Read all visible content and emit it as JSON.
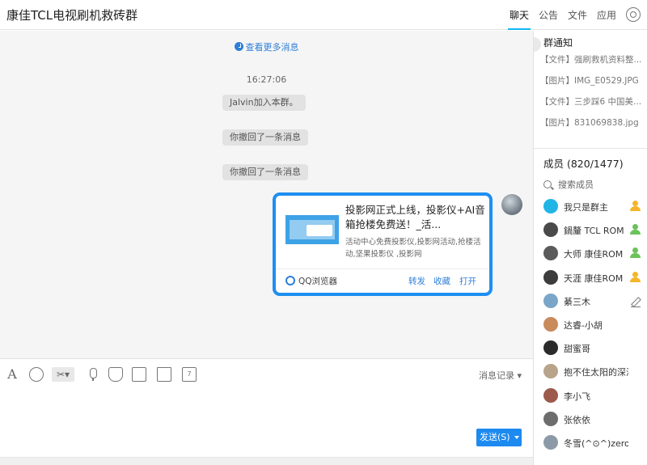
{
  "header": {
    "title": "康佳TCL电视刷机救砖群",
    "tabs": [
      {
        "label": "聊天",
        "active": true
      },
      {
        "label": "公告",
        "active": false
      },
      {
        "label": "文件",
        "active": false
      },
      {
        "label": "应用",
        "active": false
      }
    ]
  },
  "chat": {
    "more_messages": "查看更多消息",
    "timestamp": "16:27:06",
    "system_messages": [
      "Jalvin加入本群。",
      "你撤回了一条消息",
      "你撤回了一条消息"
    ],
    "card": {
      "title": "投影网正式上线，投影仪+AI音箱抢楼免费送！_活...",
      "description": "活动中心免费投影仪,投影网活动,抢楼活动,坚果投影仪 ,投影网",
      "source": "QQ浏览器",
      "actions": [
        "转发",
        "收藏",
        "打开"
      ]
    }
  },
  "toolbar": {
    "font_glyph": "A",
    "history": "消息记录",
    "calendar_day": "7"
  },
  "input": {
    "send_label": "发送(S)"
  },
  "sidebar": {
    "notice_title": "群通知",
    "notices": [
      "【文件】强刷救机资料整...",
      "【图片】IMG_E0529.JPG",
      "【文件】三步踩6 中国美...",
      "【图片】831069838.jpg"
    ],
    "members_title": "成员 (820/1477)",
    "search_label": "搜索成员",
    "members": [
      {
        "name": "我只是群主",
        "role": "owner",
        "color": "#21b5e6"
      },
      {
        "name": "鍋釐 TCL ROM",
        "role": "admin",
        "color": "#4a4a4a"
      },
      {
        "name": "大师 康佳ROM",
        "role": "admin",
        "color": "#5b5b5b"
      },
      {
        "name": "天涯 康佳ROM",
        "role": "owner",
        "color": "#3c3c3c"
      },
      {
        "name": "綦三木",
        "role": "",
        "color": "#7aa6c9"
      },
      {
        "name": "达睿-小胡",
        "role": "",
        "color": "#c98a5c"
      },
      {
        "name": "甜蜜哥",
        "role": "",
        "color": "#2b2b2b"
      },
      {
        "name": "抱不住太阳的深海",
        "role": "",
        "color": "#b8a48a"
      },
      {
        "name": "李小飞",
        "role": "",
        "color": "#9c5a4c"
      },
      {
        "name": "张依依",
        "role": "",
        "color": "#6d6d6d"
      },
      {
        "name": "冬雪(^⊙^)zero",
        "role": "",
        "color": "#8c9aa8"
      }
    ]
  }
}
